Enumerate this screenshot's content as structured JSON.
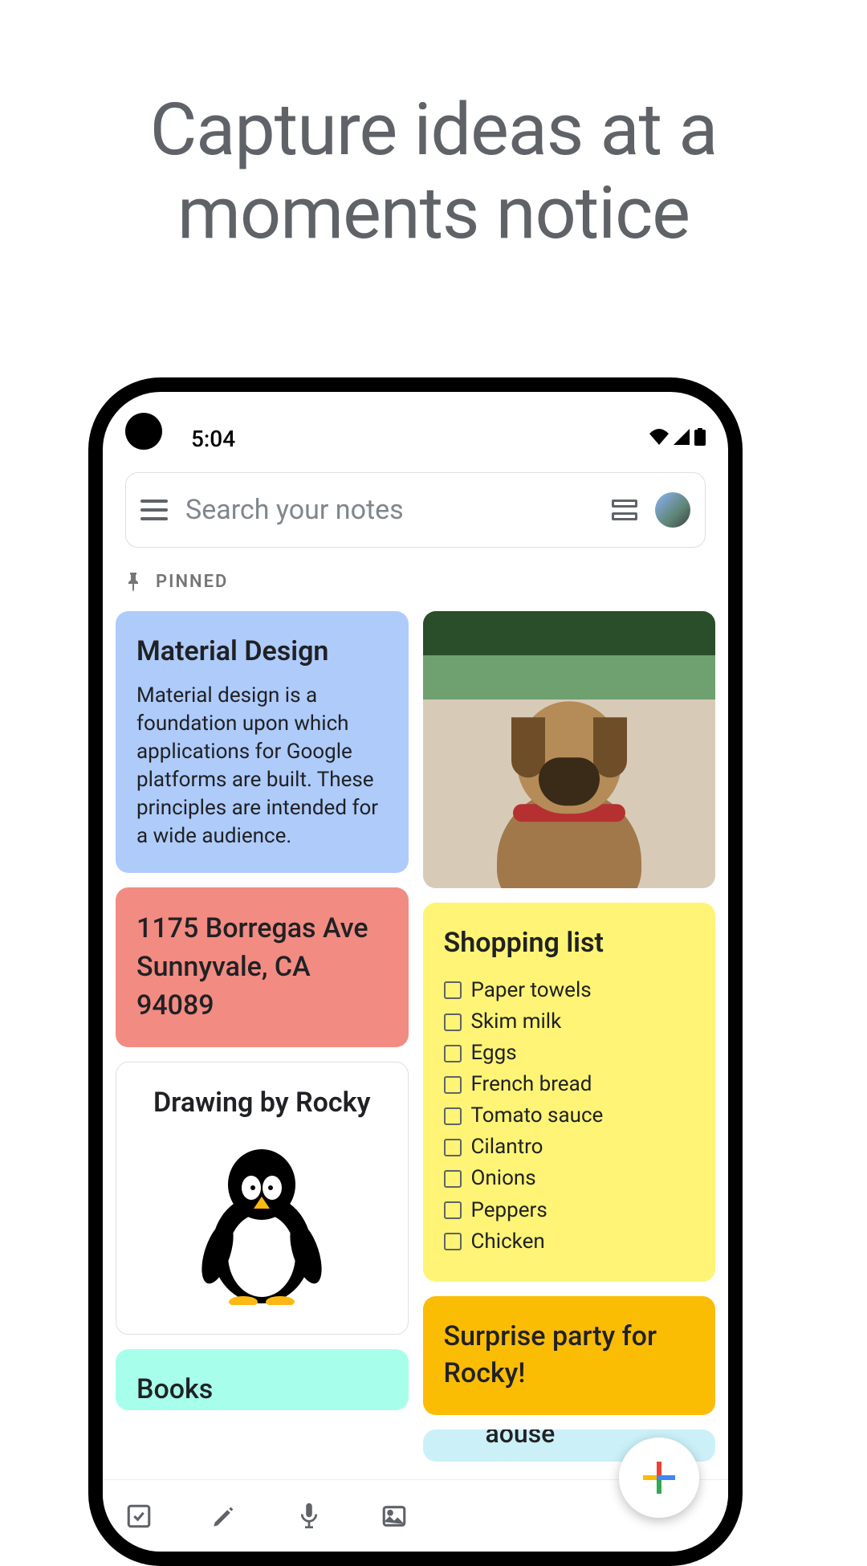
{
  "headline": "Capture ideas at a moments notice",
  "statusbar": {
    "time": "5:04"
  },
  "search": {
    "placeholder": "Search your notes"
  },
  "section": {
    "pinned_label": "PINNED"
  },
  "notes": {
    "material": {
      "title": "Material Design",
      "body": "Material design is a foundation upon which applications for Google platforms are built. These principles are intended for a wide audience."
    },
    "address": {
      "body": "1175 Borregas Ave Sunnyvale, CA 94089"
    },
    "drawing": {
      "title": "Drawing by Rocky"
    },
    "books_partial": {
      "title": "Books"
    },
    "shopping": {
      "title": "Shopping list",
      "items": [
        "Paper towels",
        "Skim milk",
        "Eggs",
        "French bread",
        "Tomato sauce",
        "Cilantro",
        "Onions",
        "Peppers",
        "Chicken"
      ]
    },
    "party": {
      "title": "Surprise party for Rocky!"
    },
    "mouse_partial": {
      "fragment": "aouse"
    }
  },
  "colors": {
    "blue": "#aecbfa",
    "pink": "#f28b82",
    "yellow": "#fff475",
    "amber": "#fbbc04",
    "mint": "#a7ffeb",
    "skyblue": "#cbf0f8"
  }
}
